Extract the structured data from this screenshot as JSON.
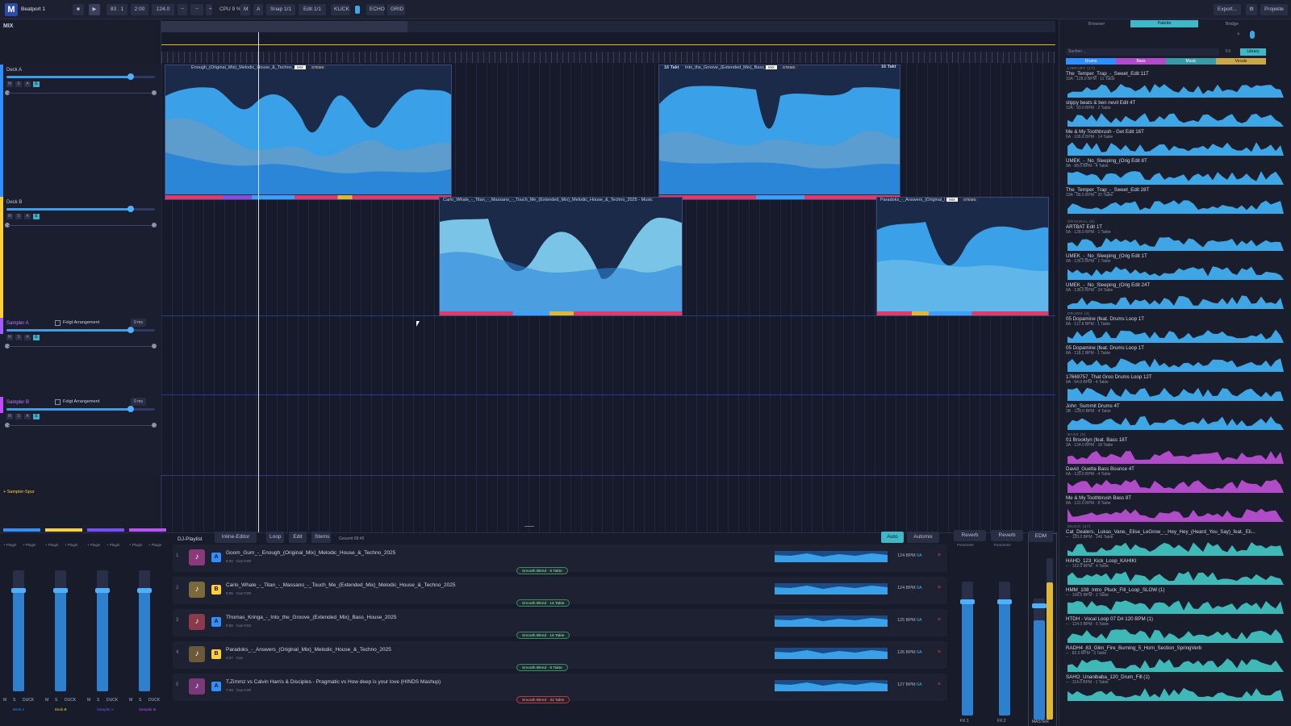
{
  "app": {
    "title": "Beatport 1"
  },
  "toolbar": {
    "counter": "83 . 1",
    "time": "2:00",
    "tempo": "124.0",
    "cpu": "CPU 9 %",
    "m_btn": "M",
    "a_btn": "A",
    "snap": "Snap 1/1",
    "edit": "Edit 1/1",
    "klick": "KLICK",
    "echo": "ECHO",
    "grid": "GRID",
    "export": "Export...",
    "projects": "Projekte"
  },
  "left": {
    "mix_label": "MIX",
    "tracks": [
      {
        "name": "Deck A",
        "color": "#2f8fff",
        "level": 0.84
      },
      {
        "name": "Deck B",
        "color": "#ffcf3a",
        "level": 0.84
      },
      {
        "name": "Sampler A",
        "color": "#a05cff",
        "follow": "Folgt Arrangement",
        "mode": "0 ms",
        "level": 0.84
      },
      {
        "name": "Sampler B",
        "color": "#c04cff",
        "follow": "Folgt Arrangement",
        "mode": "0 ms",
        "level": 0.84
      }
    ],
    "sampler_track": "+ Sampler-Spur"
  },
  "arrangement": {
    "clips": [
      {
        "title": "Enough_(Original_Mix)_Melodic_House_&_Techno_2025",
        "tag1": "MIX",
        "tag2": "STEMS"
      },
      {
        "title": "Into_the_Groove_(Extended_Mix)_Bass_House_2025",
        "tag1": "MIX",
        "tag2": "STEMS",
        "bars": "16 Takt"
      },
      {
        "title": "Carlo_Whale_-_Titan_-_Massano_-_Touch_Me_(Extended_Mix)_Melodic_House_&_Techno_2025 - Music",
        "tag1": "MIX",
        "tag2": "STEMS"
      },
      {
        "title": "Paradoks_-_Answers_(Original_Mix)_Melodic_House_&_Techno_2025 - Music",
        "tag1": "MIX",
        "tag2": "STEMS",
        "bars": "16 Takt"
      }
    ]
  },
  "library": {
    "tabs": [
      "Browser",
      "Palette",
      "Bridge"
    ],
    "search_placeholder": "Suchen ...",
    "fx": "FX",
    "library_btn": "Library",
    "cats": [
      "Drums",
      "Bass",
      "Music",
      "Vocals"
    ],
    "sections": {
      "library": "LIBRARY (17)",
      "original": "ORIGINAL (5)",
      "drums": "DRUMS (4)",
      "bass": "BASS (3)",
      "music": "MUSIC (47)"
    },
    "items": [
      {
        "title": "The_Temper_Trap_-_Sweet_Edit 11T",
        "sub": "10A · 128.0 BPM · 11 Takte",
        "color": "#3fa6e6"
      },
      {
        "title": "slippy beats & ben nevil Edit 4T",
        "sub": "10A · 93.0 BPM · 2 Takte",
        "color": "#3fa6e6"
      },
      {
        "title": "Me & My Toothbrush - Get Edit 16T",
        "sub": "6A · 106.8 BPM · 14 Takte",
        "color": "#3fa6e6"
      },
      {
        "title": "UMEK_-_No_Sleeping_(Orig Edit 8T",
        "sub": "9A · 88.0 BPM · 4 Takte",
        "color": "#3fa6e6"
      },
      {
        "title": "The_Temper_Trap_-_Sweet_Edit 28T",
        "sub": "10A · 86.5 BPM · 20 Takte",
        "color": "#3fa6e6"
      },
      {
        "title": "ARTBAT Edit 1T",
        "sub": "5A · 128.0 BPM · 1 Takte",
        "color": "#3fa6e6"
      },
      {
        "title": "UMEK_-_No_Sleeping_(Orig Edit 1T",
        "sub": "9A · 136.0 BPM · 1 Takte",
        "color": "#3fa6e6"
      },
      {
        "title": "UMEK_-_No_Sleeping_(Orig Edit 24T",
        "sub": "9A · 136.0 BPM · 24 Takte",
        "color": "#3fa6e6"
      },
      {
        "title": "05 Dopamine (feat. Drums Loop 1T",
        "sub": "8A · 117.8 BPM · 1 Takte",
        "color": "#3fa6e6"
      },
      {
        "title": "05 Dopamine (feat. Drums Loop 1T",
        "sub": "8A · 118.2 BPM · 1 Takte",
        "color": "#3fa6e6"
      },
      {
        "title": "17669757_That Groo Drums Loop 12T",
        "sub": "9A · 94.8 BPM · 4 Takte",
        "color": "#3fa6e6"
      },
      {
        "title": "John_Summit Drums 4T",
        "sub": "3B · 128.0 BPM · 4 Takte",
        "color": "#3fa6e6"
      },
      {
        "title": "01 Brooklyn (feat. Bass 18T",
        "sub": "3A · 124.0 BPM · 18 Takte",
        "color": "#b04cc8"
      },
      {
        "title": "David_Guetta Bass Bounce 4T",
        "sub": "6A · 120.0 BPM · 4 Takte",
        "color": "#b04cc8"
      },
      {
        "title": "Me & My Toothbrush Bass 8T",
        "sub": "8A · 122.0 BPM · 8 Takte",
        "color": "#b04cc8"
      },
      {
        "title": "Cat_Dealers,_Lukas_Vane,_Elise_LeGrow_-_Hey_Hey_(Heard_You_Say)_feat._Eli...",
        "sub": "-- · 120.0 BPM · 146 Takte",
        "color": "#3fb8b8"
      },
      {
        "title": "HAHD_123_Kick_Loop_KAHIKI",
        "sub": "-- · 122.0 BPM · 4 Takte",
        "color": "#3fb8b8"
      },
      {
        "title": "HMM_108_Intro_Pluck_Fill_Loop_SLOW (1)",
        "sub": "-- · 108.0 BPM · 2 Takte",
        "color": "#3fb8b8"
      },
      {
        "title": "HTDH - Vocal Loop 07 D# 120 BPM (1)",
        "sub": "-- · 124.0 BPM · 5 Takte",
        "color": "#3fb8b8"
      },
      {
        "title": "RADH4_83_Glim_Fire_Burning_5_Horn_Section_SpringVerb",
        "sub": "-- · 82.0 BPM · 3 Takte",
        "color": "#3fb8b8"
      },
      {
        "title": "SAHO_Unanibaba_120_Drum_Fill (1)",
        "sub": "-- · 114.0 BPM · 1 Takte",
        "color": "#3fb8b8"
      }
    ]
  },
  "playlist": {
    "title": "DJ-Playlist",
    "dropdown": "Inline-Editor",
    "loop": "Loop",
    "edit": "Edit",
    "stems": "Stems",
    "total": "Gesamt 68:45",
    "auto": "Auto",
    "automix": "Automix",
    "rows": [
      {
        "num": "1",
        "title": "Goom_Gum_-_Enough_(Original_Mix)_Melodic_House_&_Techno_2025",
        "sub": "6:24 · Cue 0:00",
        "bpm": "124 BPM",
        "key": "6A",
        "badge": "A",
        "badge_color": "#2f8fff",
        "art": "#8a3a7a",
        "blend": "Smooth Blend · 8 Takte"
      },
      {
        "num": "2",
        "title": "Carlo_Whale_-_Titan_-_Massano_-_Touch_Me_(Extended_Mix)_Melodic_House_&_Techno_2025",
        "sub": "5:06 · Cue 0:00",
        "bpm": "124 BPM",
        "key": "6A",
        "badge": "B",
        "badge_color": "#ffcf3a",
        "art": "#7a6a3a",
        "blend": "Smooth Blend · 16 Takte"
      },
      {
        "num": "3",
        "title": "Thomas_Kringa_-_Into_the_Groove_(Extended_Mix)_Bass_House_2025",
        "sub": "5:58 · Cue 0:02",
        "bpm": "125 BPM",
        "key": "6A",
        "badge": "A",
        "badge_color": "#2f8fff",
        "art": "#8a3a4a",
        "blend": "Smooth Blend · 16 Takte"
      },
      {
        "num": "4",
        "title": "Paradoks_-_Answers_(Original_Mix)_Melodic_House_&_Techno_2025",
        "sub": "4:27 · Cue",
        "bpm": "126 BPM",
        "key": "6A",
        "badge": "B",
        "badge_color": "#ffcf3a",
        "art": "#6a5a3a",
        "blend": "Smooth Blend · 8 Takte"
      },
      {
        "num": "5",
        "title": "T.Zimmz vs Calvin Harris & Disciples - Pragmatic vs How deep is your love (HINDS Mashup)",
        "sub": "7:29 · Cue 0:00",
        "bpm": "127 BPM",
        "key": "6A",
        "badge": "A",
        "badge_color": "#2f8fff",
        "art": "#7a3a7a",
        "blend": "Smooth Blend · 32 Takte"
      }
    ]
  },
  "mixer": {
    "channels": [
      {
        "name": "Deck A",
        "color": "#2f8fff",
        "level": 0.82
      },
      {
        "name": "Deck B",
        "color": "#ffcf3a",
        "level": 0.82
      },
      {
        "name": "Sampler A",
        "color": "#7a4cff",
        "level": 0.82
      },
      {
        "name": "Sampler B",
        "color": "#c04cff",
        "level": 0.82
      }
    ],
    "m": "M",
    "s": "S",
    "duck": "DUCK",
    "plugin": "+ Plugin",
    "fx1": "Reverb",
    "fx2": "Reverb",
    "fx1_label": "FX 1",
    "fx2_label": "FX 2",
    "param": "Parameter",
    "edm": "EDM",
    "master": "MASTER"
  }
}
